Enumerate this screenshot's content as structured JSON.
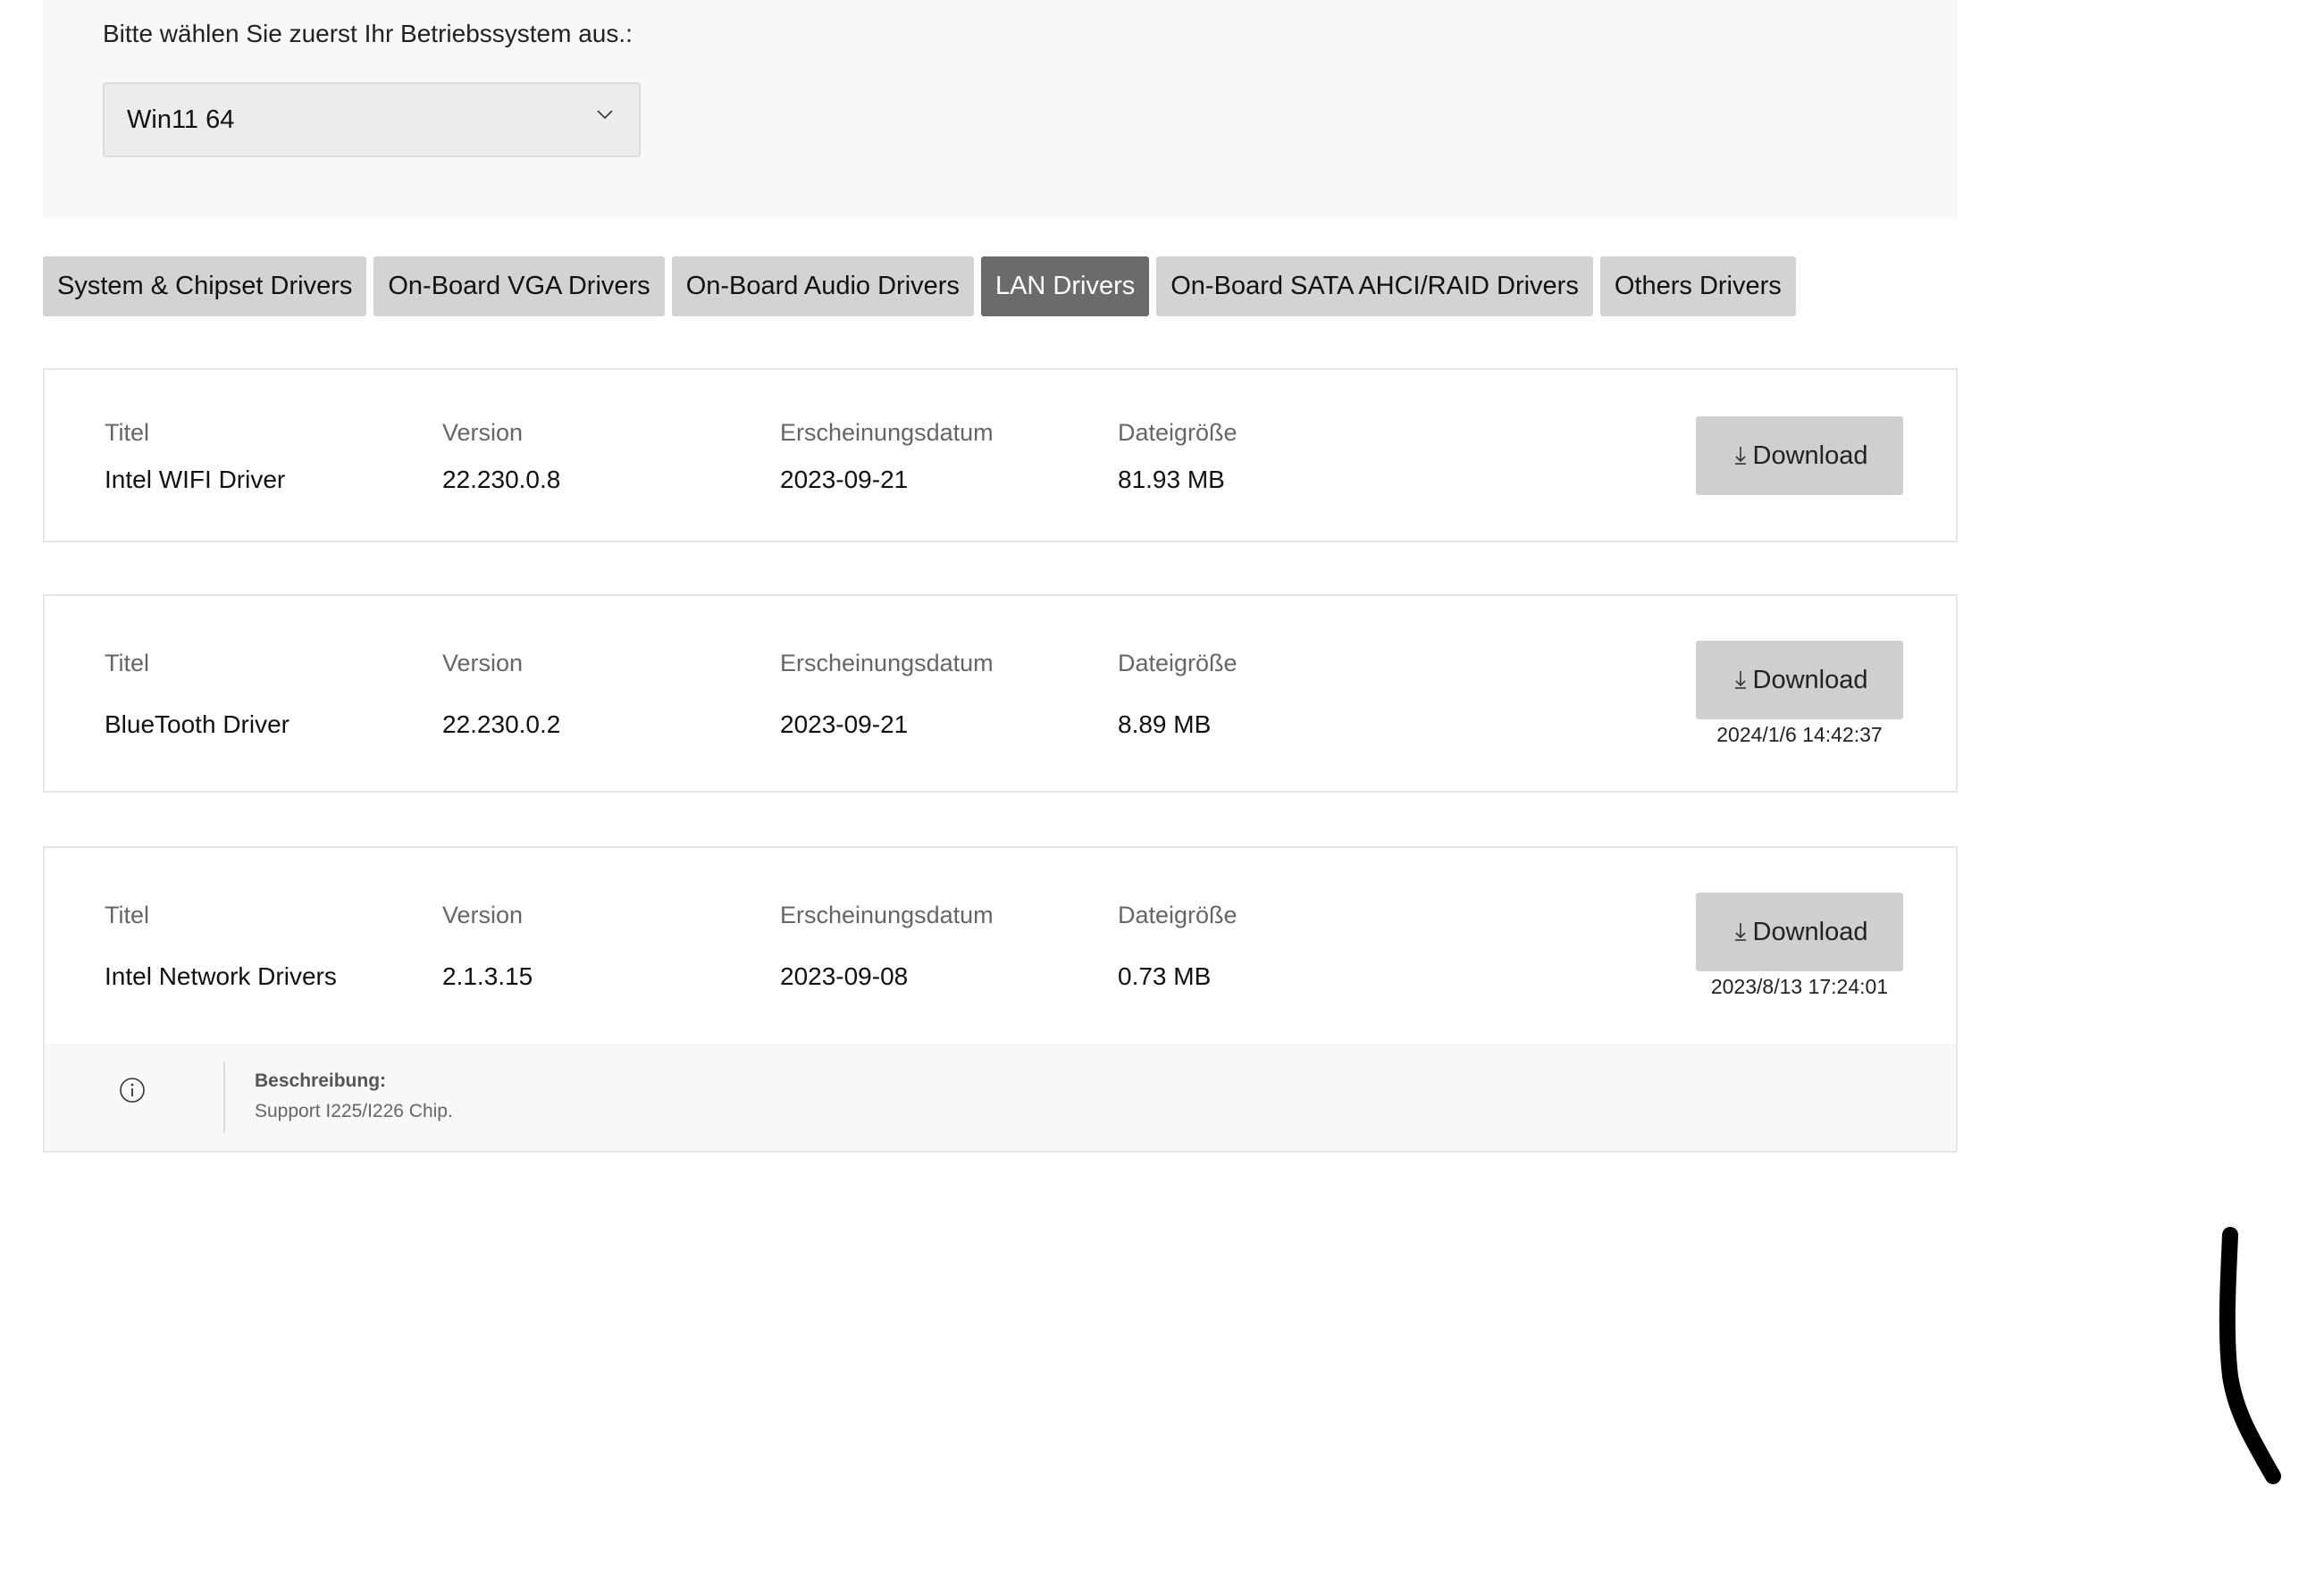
{
  "os_selector": {
    "prompt": "Bitte wählen Sie zuerst Ihr Betriebssystem aus.:",
    "selected": "Win11 64"
  },
  "tabs": [
    {
      "label": "System & Chipset Drivers",
      "active": false
    },
    {
      "label": "On-Board VGA Drivers",
      "active": false
    },
    {
      "label": "On-Board Audio Drivers",
      "active": false
    },
    {
      "label": "LAN Drivers",
      "active": true
    },
    {
      "label": "On-Board SATA AHCI/RAID Drivers",
      "active": false
    },
    {
      "label": "Others Drivers",
      "active": false
    }
  ],
  "columns": {
    "title": "Titel",
    "version": "Version",
    "date": "Erscheinungsdatum",
    "size": "Dateigröße"
  },
  "drivers": [
    {
      "title": "Intel WIFI Driver",
      "version": "22.230.0.8",
      "date": "2023-09-21",
      "size": "81.93 MB",
      "download_label": "Download",
      "timestamp": ""
    },
    {
      "title": "BlueTooth Driver",
      "version": "22.230.0.2",
      "date": "2023-09-21",
      "size": "8.89 MB",
      "download_label": "Download",
      "timestamp": "2024/1/6 14:42:37"
    },
    {
      "title": "Intel Network Drivers",
      "version": "2.1.3.15",
      "date": "2023-09-08",
      "size": "0.73 MB",
      "download_label": "Download",
      "timestamp": "2023/8/13 17:24:01",
      "description_title": "Beschreibung:",
      "description_text": "Support I225/I226 Chip."
    }
  ],
  "icons": {
    "dropdown": "chevron-down-icon",
    "download": "download-arrow-icon",
    "info": "info-icon"
  },
  "colors": {
    "tab_active_bg": "#6b6b6b",
    "tab_bg": "#d3d3d3",
    "button_bg": "#cfcfcf",
    "panel_bg": "#f8f8f8"
  }
}
